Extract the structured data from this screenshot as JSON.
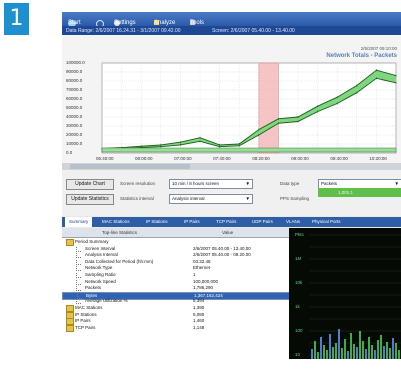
{
  "badge": "1",
  "toolbar": {
    "start": "Start",
    "settings": "Settings",
    "analyze": "Analyze",
    "tools": "Tools"
  },
  "date_bar": {
    "range": "Data Range: 2/6/2007 16.24.31 - 3/1/2007 09.42.00",
    "screen": "Screen: 2/6/2007 05.40.00 - 13.40.00"
  },
  "chart": {
    "date_label": "2/5/2007 09:10:00",
    "title": "Network Totals - Packets",
    "y_ticks": [
      "100000.0",
      "90000.0",
      "80000.0",
      "70000.0",
      "60000.0",
      "50000.0",
      "40000.0",
      "30000.0",
      "20000.0",
      "10000.0",
      "0.0"
    ],
    "x_ticks": [
      "06:40:00",
      "08:00:00",
      "07:00:00",
      "07:40:00",
      "08:20:00",
      "09:00:00",
      "09:40:00",
      "10:20:00"
    ],
    "colors": {
      "area": "#7fd67f",
      "line": "#1a5c1a",
      "highlight": "#f6c4c4"
    },
    "band_x": [
      8,
      9
    ],
    "grid": true
  },
  "chart_data": {
    "type": "area",
    "title": "Network Totals - Packets",
    "x": [
      0,
      1,
      2,
      3,
      4,
      5,
      6,
      7,
      8,
      9,
      10,
      11,
      12,
      13,
      14,
      15
    ],
    "series": [
      {
        "values": [
          5000,
          6000,
          7500,
          9000,
          12000,
          17000,
          9000,
          10000,
          26000,
          38000,
          40000,
          52000,
          62000,
          75000,
          92000,
          86000
        ]
      },
      {
        "values": [
          3000,
          4500,
          6000,
          7000,
          9000,
          13000,
          7000,
          8000,
          20000,
          33000,
          35000,
          46000,
          55000,
          67000,
          83000,
          78000
        ]
      }
    ],
    "ylim": [
      0,
      100000
    ],
    "grid": true
  },
  "controls": {
    "update_chart": "Update Chart",
    "update_statistics": "Update Statistics",
    "screen_resolution_label": "Screen resolution",
    "screen_resolution_value": "10 min / 8 hours screen",
    "statistics_interval_label": "Statistics interval",
    "statistics_interval_value": "Analysis interval",
    "data_type_label": "Data type",
    "data_type_value": "Packets",
    "pps_sampling_label": "PPS Sampling",
    "pps_value": "1,001.1"
  },
  "tabs": [
    "Summary",
    "MAC Stations",
    "IP Stations",
    "IP Pairs",
    "TCP Pairs",
    "UDP Pairs",
    "VLANs",
    "Physical Ports"
  ],
  "table": {
    "headers": [
      "Top-line Statistics",
      "Value"
    ],
    "rows": [
      {
        "key": "Period Summary",
        "value": "",
        "indent": 0,
        "icon": "folder-open-icon"
      },
      {
        "key": "Screen Interval",
        "value": "2/6/2007 05.40.00 - 13.40.00",
        "indent": 1
      },
      {
        "key": "Analysis Interval",
        "value": "2/6/2007 05.40.00 - 09.20.00",
        "indent": 1
      },
      {
        "key": "Data Collected for Period (hh:mm)",
        "value": "03.32.48",
        "indent": 1
      },
      {
        "key": "Network Type",
        "value": "Ethernet",
        "indent": 1
      },
      {
        "key": "Sampling Ratio",
        "value": "1",
        "indent": 1
      },
      {
        "key": "Network Speed",
        "value": "100,000,000",
        "indent": 1
      },
      {
        "key": "Packets",
        "value": "1,786,290",
        "indent": 1
      },
      {
        "key": "Bytes",
        "value": "1,367,162,424",
        "indent": 1,
        "selected": true
      },
      {
        "key": "Average Utilization %",
        "value": "5.394",
        "indent": 1
      },
      {
        "key": "MAC Stations",
        "value": "1,390",
        "indent": 0,
        "icon": "folder-icon"
      },
      {
        "key": "IP Stations",
        "value": "5,080",
        "indent": 0,
        "icon": "folder-icon"
      },
      {
        "key": "IP Pairs",
        "value": "1,460",
        "indent": 0,
        "icon": "folder-icon"
      },
      {
        "key": "TCP Pairs",
        "value": "1,148",
        "indent": 0,
        "icon": "folder-icon"
      }
    ]
  },
  "right_panel": {
    "y_ticks": [
      "Pkts",
      "",
      "1M",
      "",
      "10k",
      "",
      "1k",
      "",
      "100",
      "",
      "10"
    ]
  }
}
